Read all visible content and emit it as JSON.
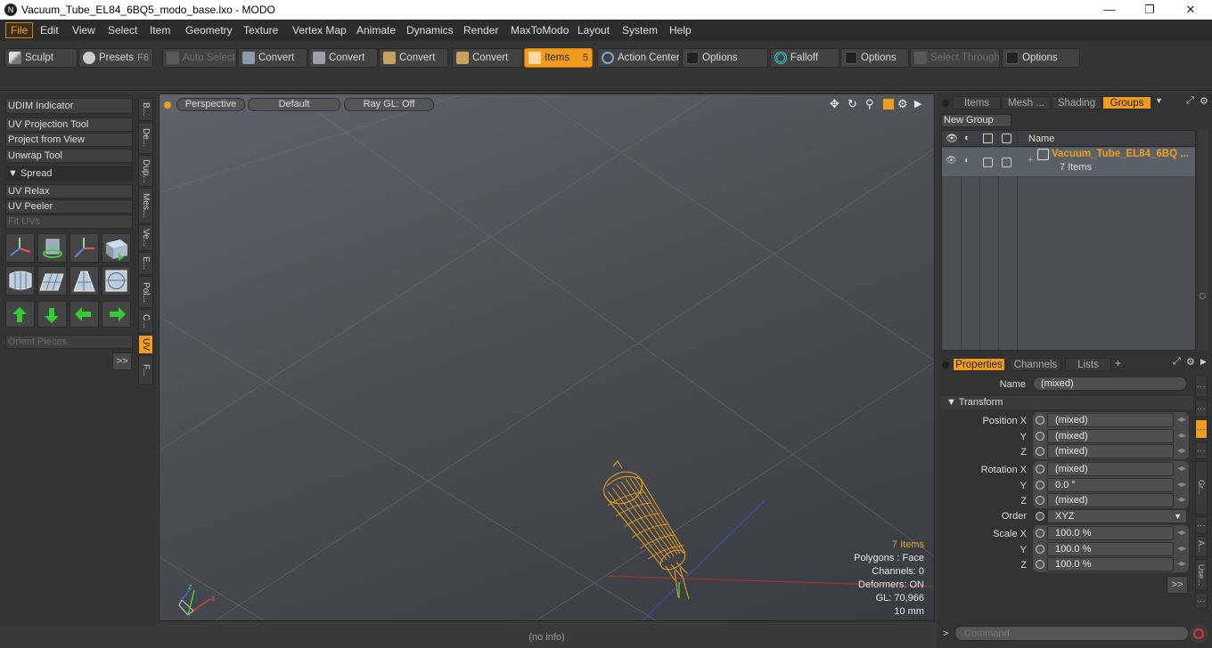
{
  "window": {
    "title": "Vacuum_Tube_EL84_6BQ5_modo_base.lxo - MODO",
    "logo": "N",
    "minimize": "—",
    "maximize": "❐",
    "close": "✕"
  },
  "menu": [
    "File",
    "Edit",
    "View",
    "Select",
    "Item",
    "Geometry",
    "Texture",
    "Vertex Map",
    "Animate",
    "Dynamics",
    "Render",
    "MaxToModo",
    "Layout",
    "System",
    "Help"
  ],
  "toolbar": {
    "sculpt": "Sculpt",
    "presets": "Presets",
    "presets_key": "F6",
    "auto_select": "Auto Select",
    "convert1": "Convert",
    "convert2": "Convert",
    "convert3": "Convert",
    "convert4": "Convert",
    "items": "Items",
    "items_key": "5",
    "action_center": "Action Center",
    "options1": "Options",
    "falloff": "Falloff",
    "options2": "Options",
    "select_through": "Select Through",
    "options3": "Options"
  },
  "left_panel": {
    "udim": "UDIM Indicator",
    "uv_projection": "UV Projection Tool",
    "project_from_view": "Project from View",
    "unwrap": "Unwrap Tool",
    "spread": "Spread",
    "uv_relax": "UV Relax",
    "uv_peeler": "UV Peeler",
    "fit_uvs": "Fit UVs",
    "orient_pieces": "Orient Pieces",
    "more": ">>",
    "vtabs": [
      "B...",
      "De...",
      "Dup...",
      "Mes...",
      "Ve...",
      "E...",
      "Pol...",
      "C...",
      "UV",
      "F..."
    ]
  },
  "viewport": {
    "perspective": "Perspective",
    "default": "Default",
    "raygl": "Ray GL: Off",
    "info": {
      "items": "7 Items",
      "polygons": "Polygons : Face",
      "channels": "Channels: 0",
      "deformers": "Deformers: ON",
      "gl": "GL: 70,966",
      "scale": "10 mm"
    }
  },
  "status": "(no info)",
  "groups_panel": {
    "tabs": [
      "Items",
      "Mesh ...",
      "Shading",
      "Groups"
    ],
    "new_group": "New Group",
    "col_name": "Name",
    "group_name": "Vacuum_Tube_EL84_6BQ ...",
    "group_count": "7 Items"
  },
  "properties": {
    "tabs": [
      "Properties",
      "Channels",
      "Lists"
    ],
    "add_tab": "+",
    "name_label": "Name",
    "name_value": "(mixed)",
    "transform": "Transform",
    "pos_x_label": "Position X",
    "pos_x": "(mixed)",
    "pos_y": "(mixed)",
    "pos_z": "(mixed)",
    "rot_x_label": "Rotation X",
    "rot_x": "(mixed)",
    "rot_y": "0.0 °",
    "rot_z": "(mixed)",
    "order_label": "Order",
    "order": "XYZ",
    "scale_x_label": "Scale X",
    "scale_x": "100.0 %",
    "scale_y": "100.0 %",
    "scale_z": "100.0 %",
    "y": "Y",
    "z": "Z",
    "more": ">>",
    "side_tabs": [
      "Gr...",
      "A...",
      "Use..."
    ]
  },
  "command": {
    "prompt": ">",
    "placeholder": "Command"
  },
  "colors": {
    "accent": "#f29c1e",
    "selection_orange": "#e8a020"
  }
}
